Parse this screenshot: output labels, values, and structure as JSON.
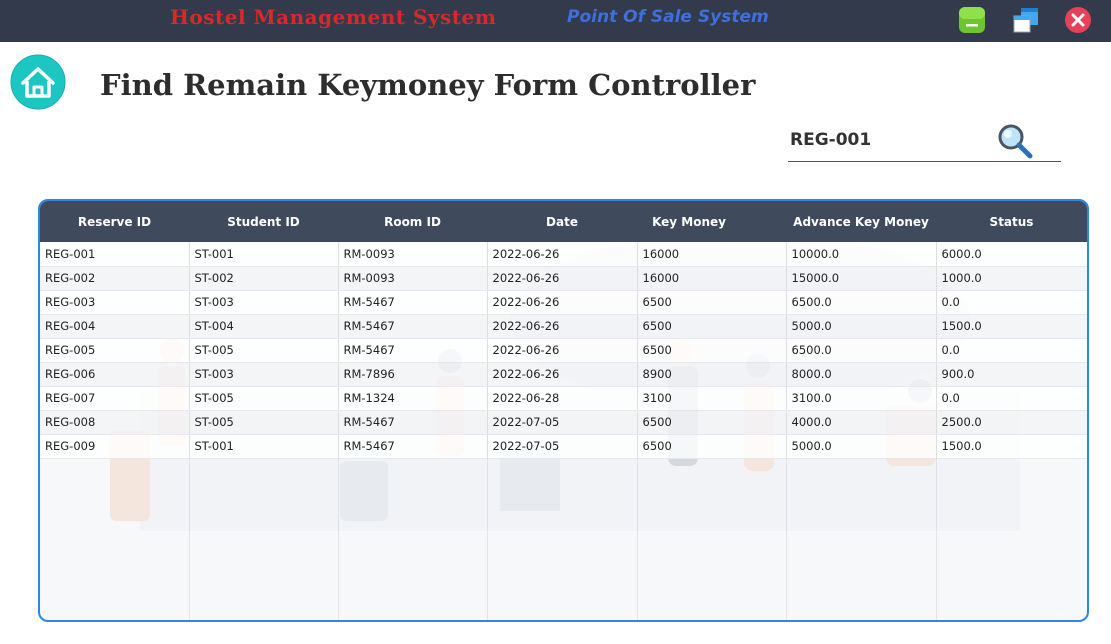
{
  "titlebar": {
    "app_title": "Hostel Management System",
    "pos_title": "Point Of Sale System",
    "minimize_icon": "minimize-icon",
    "maximize_icon": "maximize-icon",
    "close_icon": "close-icon"
  },
  "header": {
    "home_icon": "home-icon",
    "title": "Find Remain Keymoney Form Controller"
  },
  "search": {
    "value": "REG-001",
    "icon": "search-icon"
  },
  "table": {
    "columns": [
      "Reserve ID",
      "Student ID",
      "Room ID",
      "Date",
      "Key Money",
      "Advance Key Money",
      "Status"
    ],
    "rows": [
      [
        "REG-001",
        "ST-001",
        "RM-0093",
        "2022-06-26",
        "16000",
        "10000.0",
        "6000.0"
      ],
      [
        "REG-002",
        "ST-002",
        "RM-0093",
        "2022-06-26",
        "16000",
        "15000.0",
        "1000.0"
      ],
      [
        "REG-003",
        "ST-003",
        "RM-5467",
        "2022-06-26",
        "6500",
        "6500.0",
        "0.0"
      ],
      [
        "REG-004",
        "ST-004",
        "RM-5467",
        "2022-06-26",
        "6500",
        "5000.0",
        "1500.0"
      ],
      [
        "REG-005",
        "ST-005",
        "RM-5467",
        "2022-06-26",
        "6500",
        "6500.0",
        "0.0"
      ],
      [
        "REG-006",
        "ST-003",
        "RM-7896",
        "2022-06-26",
        "8900",
        "8000.0",
        "900.0"
      ],
      [
        "REG-007",
        "ST-005",
        "RM-1324",
        "2022-06-28",
        "3100",
        "3100.0",
        "0.0"
      ],
      [
        "REG-008",
        "ST-005",
        "RM-5467",
        "2022-07-05",
        "6500",
        "4000.0",
        "2500.0"
      ],
      [
        "REG-009",
        "ST-001",
        "RM-5467",
        "2022-07-05",
        "6500",
        "5000.0",
        "1500.0"
      ]
    ]
  },
  "colors": {
    "titlebar_bg": "#323a4b",
    "app_title": "#d62a2a",
    "pos_title": "#3f6fdc",
    "table_header_bg": "#3f4a5c",
    "panel_border": "#2f86e0",
    "home_icon_bg": "#1cc7c3"
  }
}
